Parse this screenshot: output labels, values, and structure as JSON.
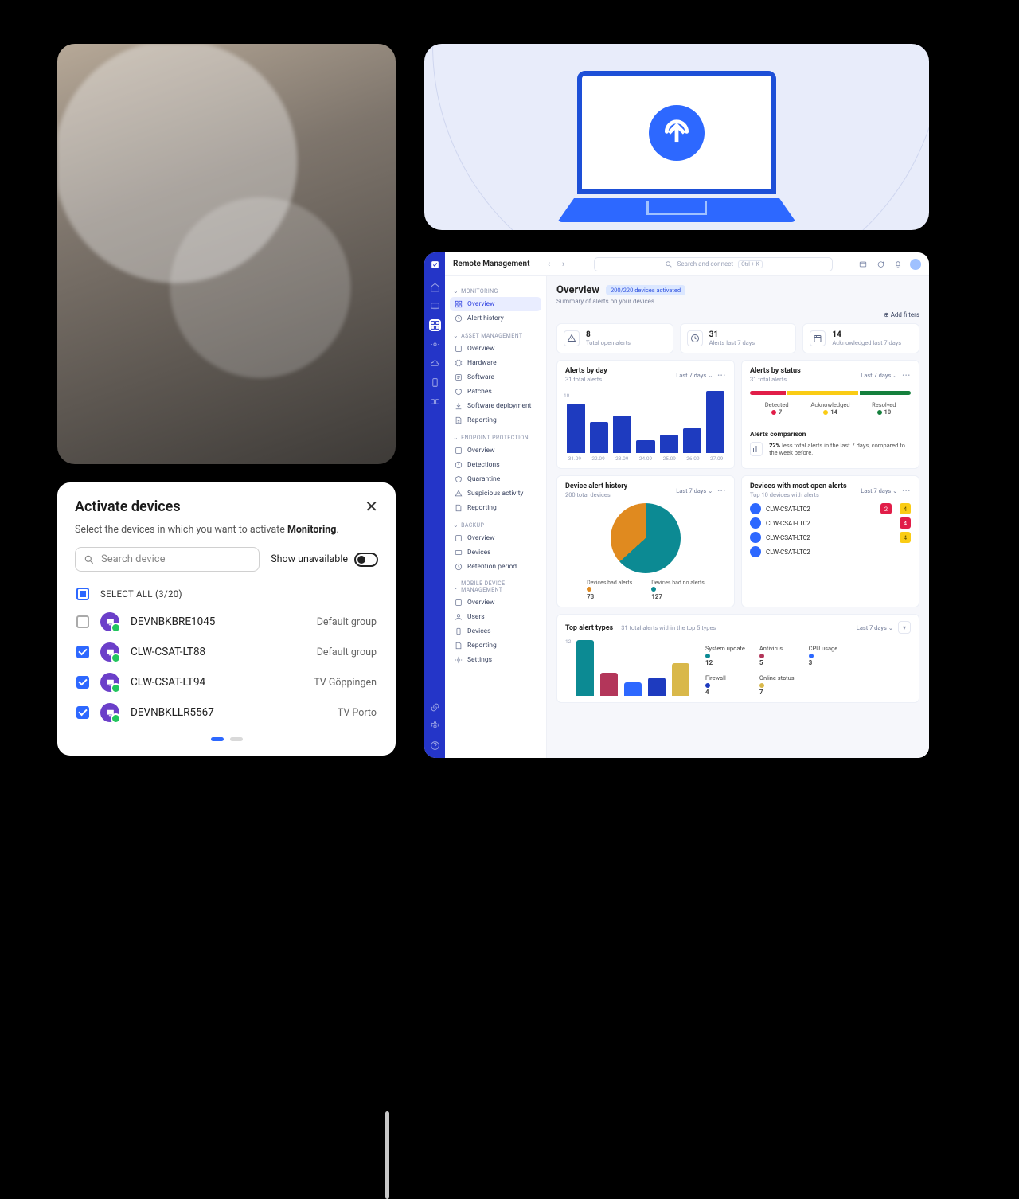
{
  "activate": {
    "title": "Activate devices",
    "subtitle_pre": "Select the devices in which you want to activate ",
    "subtitle_strong": "Monitoring",
    "subtitle_post": ".",
    "search_placeholder": "Search device",
    "show_unavailable": "Show unavailable",
    "select_all": "SELECT ALL (3/20)",
    "rows": [
      {
        "checked": false,
        "name": "DEVNBKBRE1045",
        "group": "Default group"
      },
      {
        "checked": true,
        "name": "CLW-CSAT-LT88",
        "group": "Default group"
      },
      {
        "checked": true,
        "name": "CLW-CSAT-LT94",
        "group": "TV Göppingen"
      },
      {
        "checked": true,
        "name": "DEVNBKLLR5567",
        "group": "TV Porto"
      }
    ]
  },
  "app": {
    "title": "Remote Management",
    "search_placeholder": "Search and connect",
    "shortcut": "Ctrl + K",
    "sidebar": {
      "monitoring": {
        "label": "MONITORING",
        "items": [
          "Overview",
          "Alert history"
        ]
      },
      "asset": {
        "label": "ASSET MANAGEMENT",
        "items": [
          "Overview",
          "Hardware",
          "Software",
          "Patches",
          "Software deployment",
          "Reporting"
        ]
      },
      "endpoint": {
        "label": "ENDPOINT PROTECTION",
        "items": [
          "Overview",
          "Detections",
          "Quarantine",
          "Suspicious activity",
          "Reporting"
        ]
      },
      "backup": {
        "label": "BACKUP",
        "items": [
          "Overview",
          "Devices",
          "Retention period"
        ]
      },
      "mdm": {
        "label": "MOBILE DEVICE MANAGEMENT",
        "items": [
          "Overview",
          "Users",
          "Devices",
          "Reporting",
          "Settings"
        ]
      }
    },
    "overview": {
      "heading": "Overview",
      "chip": "200/220 devices activated",
      "sub": "Summary of alerts on your devices.",
      "add_filters": "Add filters",
      "stats": [
        {
          "num": "8",
          "label": "Total open alerts"
        },
        {
          "num": "31",
          "label": "Alerts last 7 days"
        },
        {
          "num": "14",
          "label": "Acknowledged last 7 days"
        }
      ],
      "range": "Last 7 days"
    },
    "alerts_by_day": {
      "title": "Alerts by day",
      "sub": "31 total alerts",
      "ytick": "10"
    },
    "alerts_by_status": {
      "title": "Alerts by status",
      "sub": "31 total alerts",
      "segments": [
        {
          "label": "Detected",
          "value": 7,
          "color": "#e11d48"
        },
        {
          "label": "Acknowledged",
          "value": 14,
          "color": "#facc15"
        },
        {
          "label": "Resolved",
          "value": 10,
          "color": "#15803d"
        }
      ],
      "compare_title": "Alerts comparison",
      "compare_pct": "22%",
      "compare_text": "less total alerts in the last 7 days, compared to the week before."
    },
    "device_history": {
      "title": "Device alert history",
      "sub": "200 total devices",
      "slices": [
        {
          "label": "Devices had alerts",
          "value": 73,
          "color": "#e08a1f"
        },
        {
          "label": "Devices had no alerts",
          "value": 127,
          "color": "#0c8a93"
        }
      ]
    },
    "most_open": {
      "title": "Devices with most open alerts",
      "sub": "Top 10 devices with alerts",
      "rows": [
        {
          "name": "CLW-CSAT-LT02",
          "red": 2,
          "yellow": 4
        },
        {
          "name": "CLW-CSAT-LT02",
          "red": 4,
          "yellow": null
        },
        {
          "name": "CLW-CSAT-LT02",
          "red": null,
          "yellow": 4
        },
        {
          "name": "CLW-CSAT-LT02",
          "red": null,
          "yellow": null
        }
      ]
    },
    "top_types": {
      "title": "Top alert types",
      "sub": "31 total alerts within the top 5 types",
      "legend": [
        {
          "label": "System update",
          "value": 12,
          "color": "#0c8a93"
        },
        {
          "label": "Antivirus",
          "value": 5,
          "color": "#b3365a"
        },
        {
          "label": "CPU usage",
          "value": 3,
          "color": "#2d68ff"
        },
        {
          "label": "Firewall",
          "value": 4,
          "color": "#1e3bbf"
        },
        {
          "label": "Online status",
          "value": 7,
          "color": "#d9b84a"
        }
      ]
    }
  },
  "chart_data": [
    {
      "type": "bar",
      "title": "Alerts by day",
      "categories": [
        "31.09",
        "22.09",
        "23.09",
        "24.09",
        "25.09",
        "26.09",
        "27.09"
      ],
      "values": [
        8,
        5,
        6,
        2,
        3,
        4,
        10
      ],
      "ylabel": "",
      "ylim": [
        0,
        10
      ]
    },
    {
      "type": "bar",
      "title": "Alerts by status",
      "categories": [
        "Detected",
        "Acknowledged",
        "Resolved"
      ],
      "values": [
        7,
        14,
        10
      ]
    },
    {
      "type": "pie",
      "title": "Device alert history",
      "categories": [
        "Devices had alerts",
        "Devices had no alerts"
      ],
      "values": [
        73,
        127
      ]
    },
    {
      "type": "bar",
      "title": "Top alert types",
      "categories": [
        "System update",
        "Antivirus",
        "CPU usage",
        "Firewall",
        "Online status"
      ],
      "values": [
        12,
        5,
        3,
        4,
        7
      ]
    }
  ]
}
